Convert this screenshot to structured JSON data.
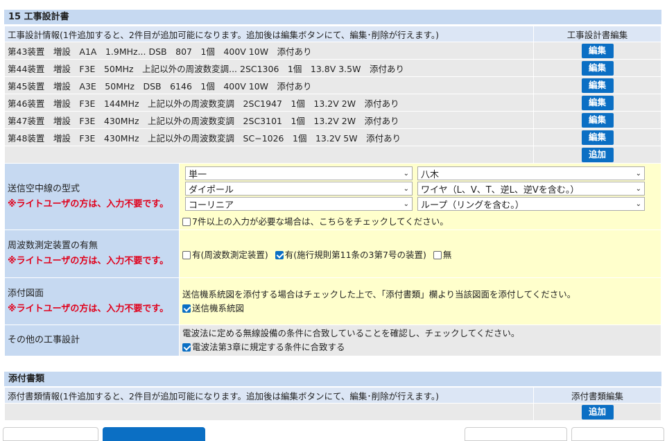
{
  "section1": {
    "title": "15 工事設計書",
    "header_info": "工事設計情報(1件追加すると、2件目が追加可能になります。追加後は編集ボタンにて、編集･削除が行えます。)",
    "header_edit": "工事設計書編集",
    "rows": [
      {
        "text": "第43装置　増設　A1A　1.9MHz...  DSB　807　1個　400V 10W　添付あり"
      },
      {
        "text": "第44装置　増設　F3E　50MHz　上記以外の周波数変調...  2SC1306　1個　13.8V 3.5W　添付あり"
      },
      {
        "text": "第45装置　増設　A3E　50MHz　DSB　6146　1個　400V 10W　添付あり"
      },
      {
        "text": "第46装置　増設　F3E　144MHz　上記以外の周波数変調　2SC1947　1個　13.2V 2W　添付あり"
      },
      {
        "text": "第47装置　増設　F3E　430MHz　上記以外の周波数変調　2SC3101　1個　13.2V 2W　添付あり"
      },
      {
        "text": "第48装置　増設　F3E　430MHz　上記以外の周波数変調　SC−1026　1個　13.2V 5W　添付あり"
      }
    ],
    "edit_label": "編集",
    "add_label": "追加"
  },
  "antenna": {
    "label": "送信空中線の型式",
    "required_note": "※ライトユーザの方は、入力不要です。",
    "selects": [
      "単一",
      "八木",
      "ダイポール",
      "ワイヤ（L、V、T、逆L、逆Vを含む。）",
      "コーリニア",
      "ループ（リングを含む。）"
    ],
    "more_check": "7件以上の入力が必要な場合は、こちらをチェックしてください。"
  },
  "freq": {
    "label": "周波数測定装置の有無",
    "required_note": "※ライトユーザの方は、入力不要です。",
    "options": [
      {
        "label": "有(周波数測定装置)",
        "checked": false
      },
      {
        "label": "有(施行規則第11条の3第7号の装置)",
        "checked": true
      },
      {
        "label": "無",
        "checked": false
      }
    ]
  },
  "drawing": {
    "label": "添付図面",
    "required_note": "※ライトユーザの方は、入力不要です。",
    "note": "送信機系統図を添付する場合はチェックした上で、「添付書類」欄より当該図面を添付してください。",
    "check_label": "送信機系統図"
  },
  "other": {
    "label": "その他の工事設計",
    "note": "電波法に定める無線設備の条件に合致していることを確認し、チェックしてください。",
    "check_label": "電波法第3章に規定する条件に合致する"
  },
  "section2": {
    "title": "添付書類",
    "header_info": "添付書類情報(1件追加すると、2件目が追加可能になります。追加後は編集ボタンにて、編集･削除が行えます。)",
    "header_edit": "添付書類編集",
    "add_label": "追加"
  },
  "colors": {
    "accent": "#0b6fc4",
    "label_bg": "#c6d9f1",
    "value_bg": "#ffffcc",
    "required": "#e0001b"
  }
}
